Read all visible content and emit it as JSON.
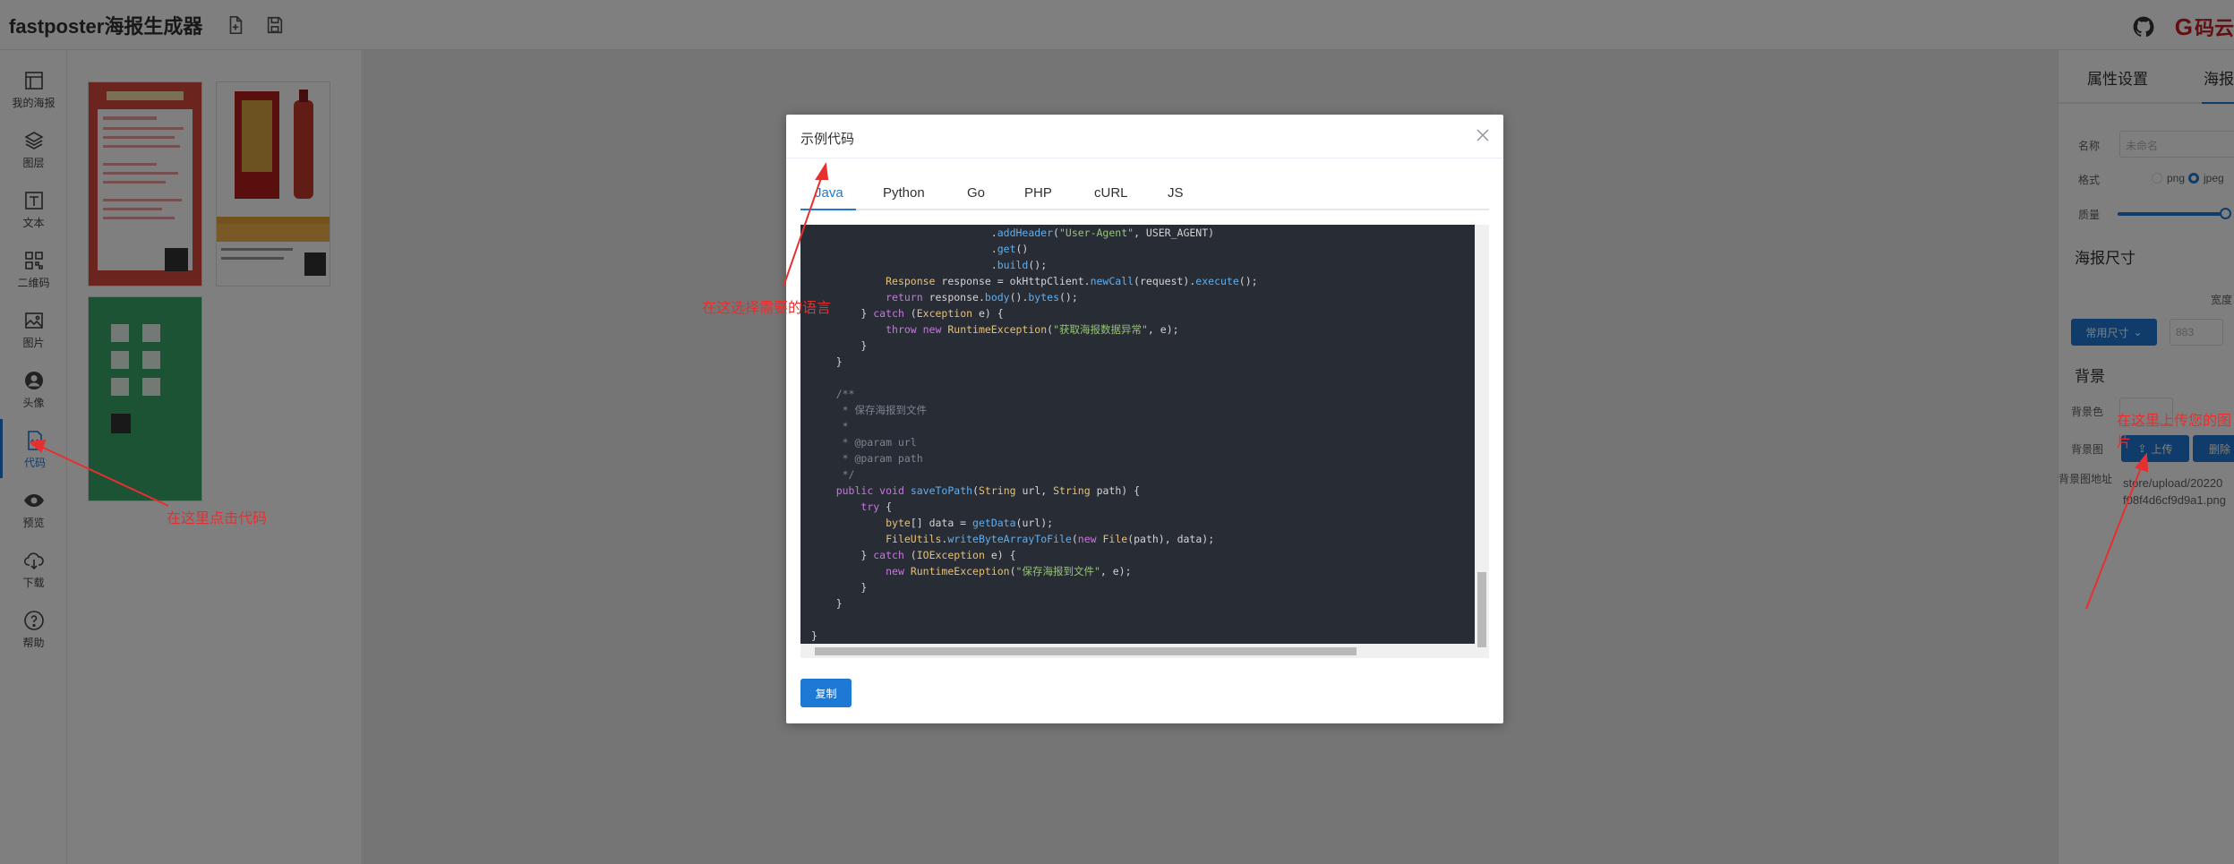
{
  "header": {
    "app_title": "fastposter海报生成器",
    "gitee_label": "码云"
  },
  "sidebar": {
    "items": [
      {
        "label": "我的海报",
        "icon": "layout-icon"
      },
      {
        "label": "图层",
        "icon": "layers-icon"
      },
      {
        "label": "文本",
        "icon": "text-icon"
      },
      {
        "label": "二维码",
        "icon": "qrcode-icon"
      },
      {
        "label": "图片",
        "icon": "image-icon"
      },
      {
        "label": "头像",
        "icon": "avatar-icon"
      },
      {
        "label": "代码",
        "icon": "code-icon"
      },
      {
        "label": "预览",
        "icon": "eye-icon"
      },
      {
        "label": "下载",
        "icon": "download-cloud-icon"
      },
      {
        "label": "帮助",
        "icon": "help-icon"
      }
    ]
  },
  "right_panel": {
    "tabs": [
      "属性设置",
      "海报"
    ],
    "name_label": "名称",
    "name_placeholder": "未命名",
    "format_label": "格式",
    "format_png": "png",
    "format_jpeg": "jpeg",
    "quality_label": "质量",
    "size_section": "海报尺寸",
    "width_label": "宽度",
    "size_button": "常用尺寸",
    "width_value": "883",
    "bg_section": "背景",
    "bg_color_label": "背景色",
    "bg_image_label": "背景图",
    "upload_button": "上传",
    "delete_button": "删除",
    "bg_url_label": "背景图地址",
    "bg_url_line1": "store/upload/20220",
    "bg_url_line2": "f08f4d6cf9d9a1.png"
  },
  "dialog": {
    "title": "示例代码",
    "tabs": [
      "Java",
      "Python",
      "Go",
      "PHP",
      "cURL",
      "JS"
    ],
    "active_tab": "Java",
    "copy_button": "复制"
  },
  "annotations": {
    "select_language": "在这选择需要的语言",
    "click_code": "在这里点击代码",
    "upload_image": "在这里上传您的图片"
  }
}
